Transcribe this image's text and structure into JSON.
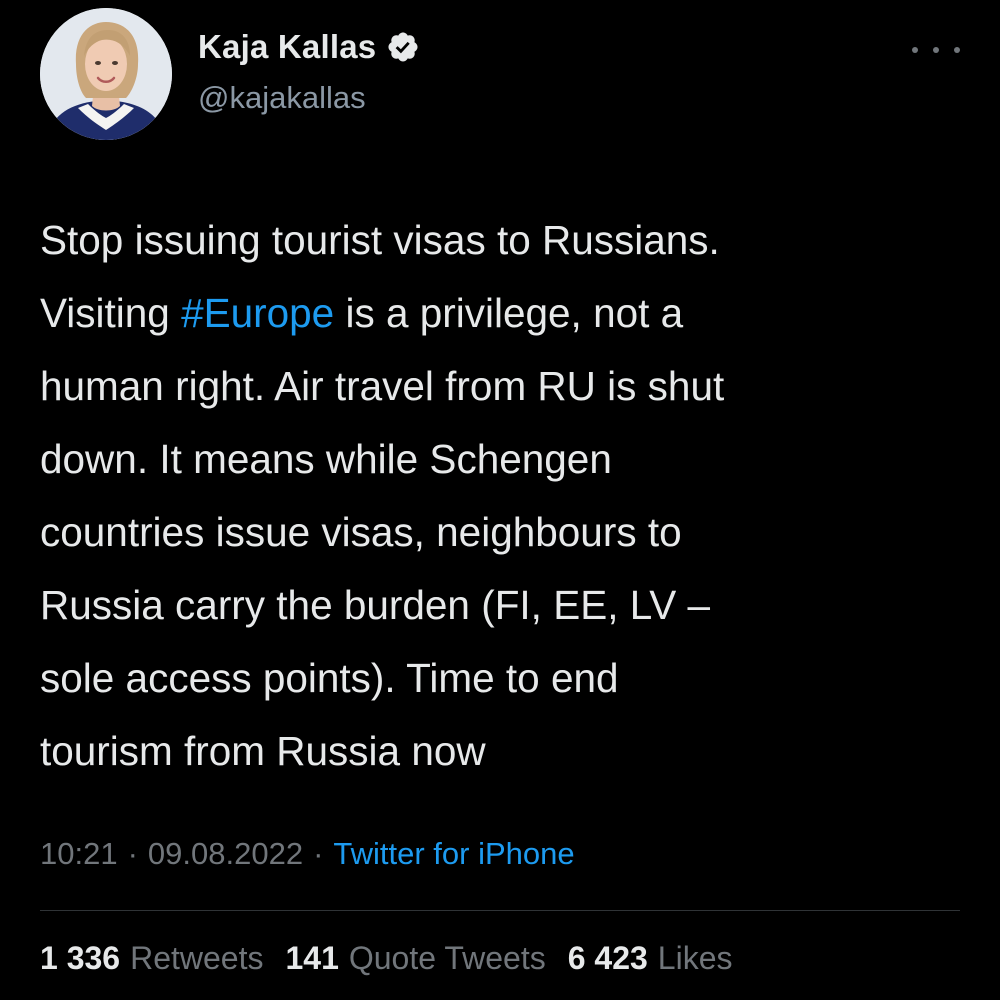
{
  "author": {
    "display_name": "Kaja Kallas",
    "handle": "@kajakallas",
    "verified": true
  },
  "tweet": {
    "text_lines": [
      {
        "before": "Stop issuing tourist visas to Russians.\n",
        "hashtag": "",
        "after": ""
      },
      {
        "before": "Visiting ",
        "hashtag": "#Europe",
        "after": " is a privilege, not a\nhuman right. Air travel from RU is shut\ndown. It means while Schengen\ncountries issue visas, neighbours to\nRussia carry the burden (FI, EE, LV –\nsole access points). Time to end\ntourism from Russia now"
      }
    ],
    "time": "10:21",
    "separator": "·",
    "date": "09.08.2022",
    "source": "Twitter for iPhone"
  },
  "stats": {
    "retweets_count": "1 336",
    "retweets_label": "Retweets",
    "quotes_count": "141",
    "quotes_label": "Quote Tweets",
    "likes_count": "6 423",
    "likes_label": "Likes"
  },
  "icons": {
    "verified": "verified-badge-icon",
    "more": "more-options-icon"
  },
  "colors": {
    "background": "#000000",
    "text": "#e7e9ea",
    "secondary": "#71767b",
    "accent": "#1d9bf0"
  }
}
